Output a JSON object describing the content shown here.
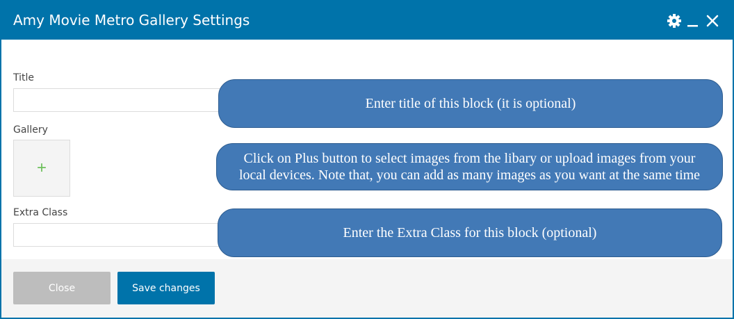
{
  "window": {
    "title": "Amy Movie Metro Gallery Settings",
    "icons": [
      "gear-icon",
      "minimize-icon",
      "close-icon"
    ]
  },
  "form": {
    "title_label": "Title",
    "title_value": "",
    "gallery_label": "Gallery",
    "gallery_add_symbol": "+",
    "extra_class_label": "Extra Class",
    "extra_class_value": ""
  },
  "annotations": {
    "title_hint": "Enter title of this block (it is optional)",
    "gallery_hint_line1": "Click on Plus button to select images from the libary or upload images from your",
    "gallery_hint_line2": "local devices. Note that, you can add as many images as you want at the same time",
    "extra_class_hint": "Enter the Extra Class for this block (optional)"
  },
  "footer": {
    "close_label": "Close",
    "save_label": "Save changes"
  },
  "colors": {
    "header": "#0073aa",
    "save_button": "#0073aa",
    "close_button": "#bdbdbd",
    "bubble": "#4279b6",
    "plus": "#6dbf5b"
  }
}
